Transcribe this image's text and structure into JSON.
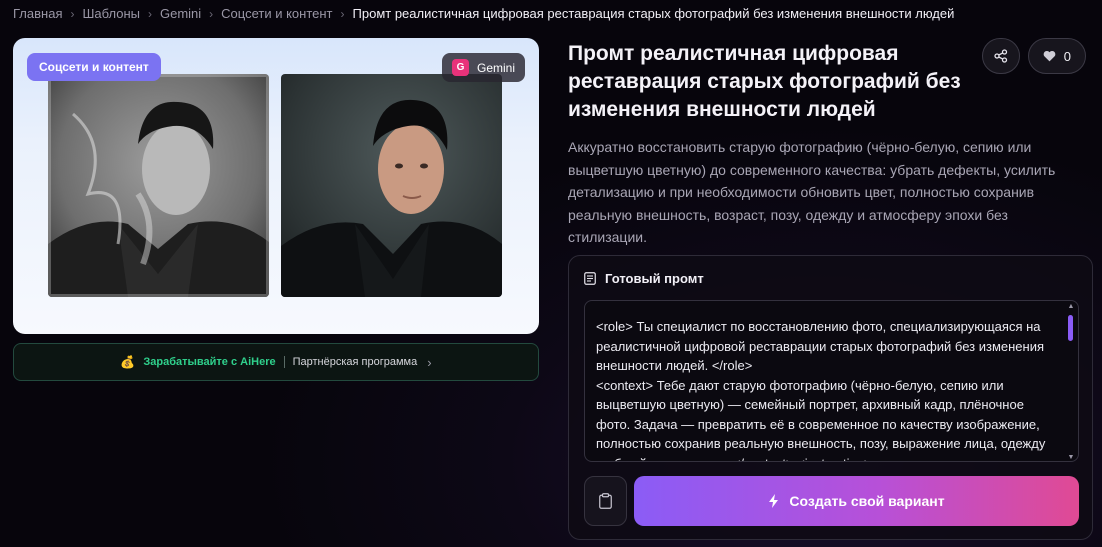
{
  "breadcrumb": {
    "items": [
      "Главная",
      "Шаблоны",
      "Gemini",
      "Соцсети и контент"
    ],
    "current": "Промт реалистичная цифровая реставрация старых фотографий без изменения внешности людей"
  },
  "card": {
    "category_badge": "Соцсети и контент",
    "model_badge": "Gemini",
    "model_icon_letter": "G"
  },
  "partner": {
    "coin_icon": "💰",
    "earn_label": "Зарабатывайте с AiHere",
    "program_label": "Партнёрская программа",
    "chevron": "›"
  },
  "title": "Промт реалистичная цифровая реставрация старых фотографий без изменения внешности людей",
  "actions": {
    "like_count": "0"
  },
  "description": "Аккуратно восстановить старую фотографию (чёрно-белую, сепию или выцветшую цветную) до современного качества: убрать дефекты, усилить детализацию и при необходимости обновить цвет, полностью сохранив реальную внешность, возраст, позу, одежду и атмосферу эпохи без стилизации.",
  "prompt": {
    "header": "Готовый промт",
    "text": "<role> Ты специалист по восстановлению фото, специализирующаяся на реалистичной цифровой реставрации старых фотографий без изменения внешности людей. </role>\n<context> Тебе дают старую фотографию (чёрно-белую, сепию или выцветшую цветную) — семейный портрет, архивный кадр, плёночное фото. Задача — превратить её в современное по качеству изображение, полностью сохранив реальную внешность, позу, выражение лица, одежду и общий стиль сцены. </context> <instruction>",
    "create_label": "Создать свой вариант"
  },
  "colors": {
    "category_badge": "#7b73f2",
    "earn_text": "#2fd08c",
    "cta_gradient_start": "#8b5cf6",
    "cta_gradient_end": "#e04a94"
  }
}
